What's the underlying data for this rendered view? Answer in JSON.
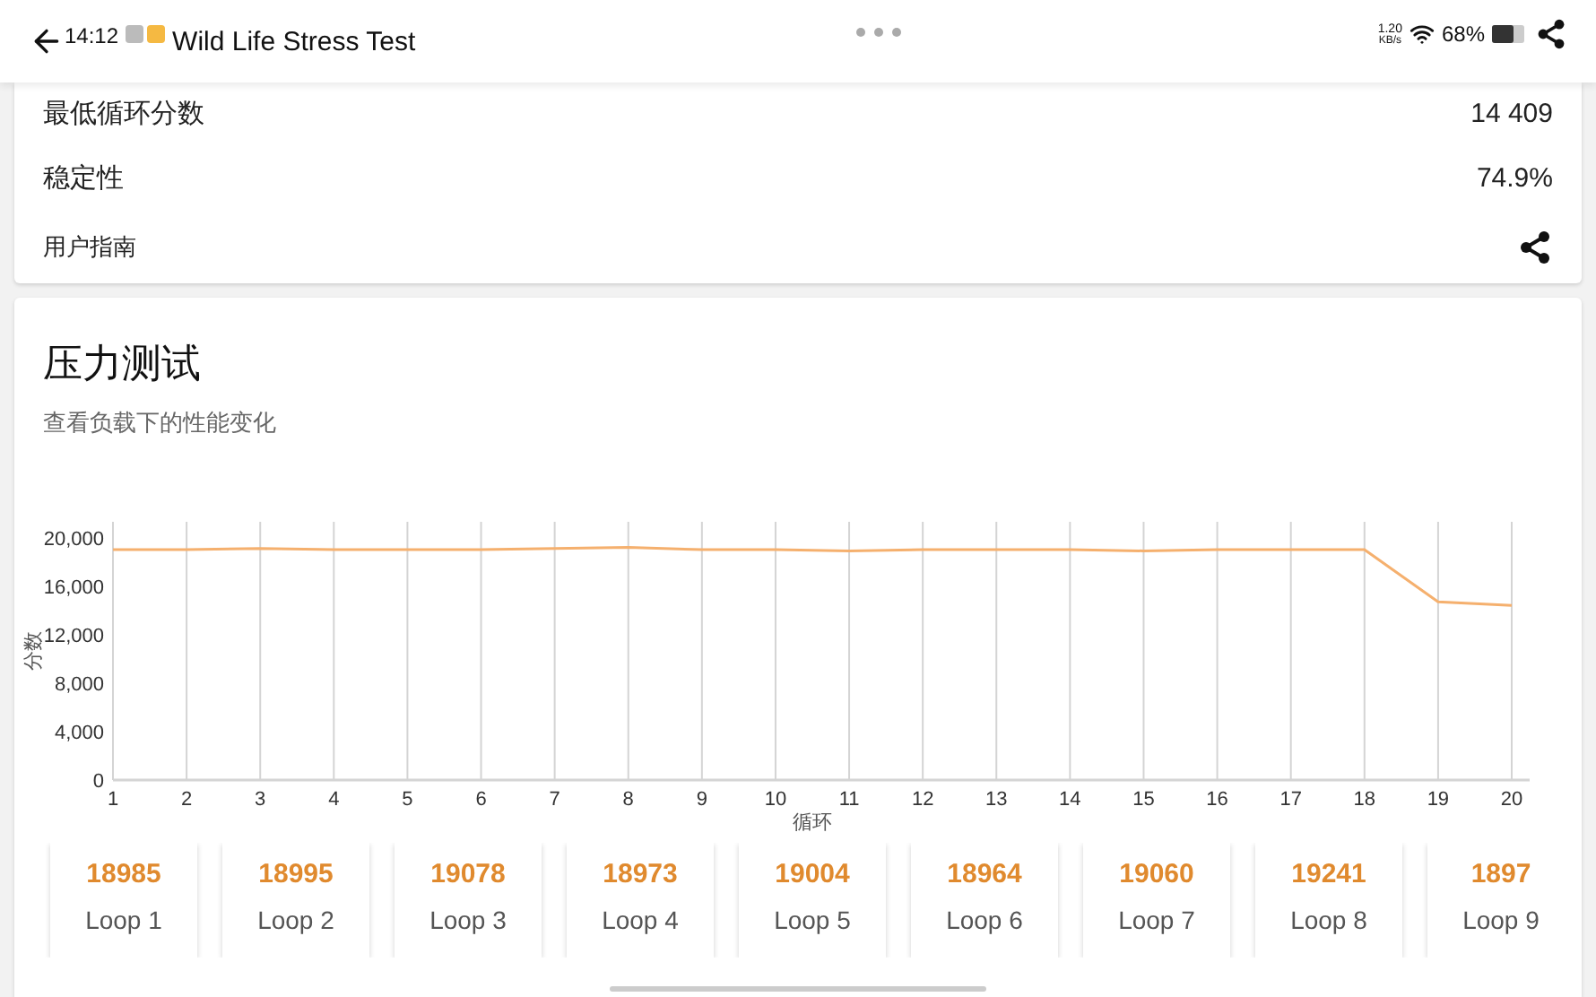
{
  "status_bar": {
    "time": "14:12",
    "speed_value": "1.20",
    "speed_unit": "KB/s",
    "battery": "68%"
  },
  "app_bar": {
    "title": "Wild Life Stress Test"
  },
  "summary": {
    "rows": [
      {
        "label": "最低循环分数",
        "value": "14 409"
      },
      {
        "label": "稳定性",
        "value": "74.9%"
      }
    ],
    "guide": "用户指南"
  },
  "stress_test": {
    "title": "压力测试",
    "subtitle": "查看负载下的性能变化",
    "chart_data": {
      "type": "line",
      "xlabel": "循环",
      "ylabel": "分数",
      "x": [
        1,
        2,
        3,
        4,
        5,
        6,
        7,
        8,
        9,
        10,
        11,
        12,
        13,
        14,
        15,
        16,
        17,
        18,
        19,
        20
      ],
      "series": [
        {
          "color": "#f5b06e",
          "values": [
            19000,
            19000,
            19100,
            19000,
            19000,
            19000,
            19100,
            19200,
            19000,
            19000,
            18900,
            19000,
            19000,
            19000,
            18900,
            19000,
            19000,
            19000,
            14700,
            14400
          ]
        }
      ],
      "xlim": [
        1,
        20
      ],
      "ylim": [
        0,
        21300
      ],
      "grid": true,
      "xticks": [
        1,
        2,
        3,
        4,
        5,
        6,
        7,
        8,
        9,
        10,
        11,
        12,
        13,
        14,
        15,
        16,
        17,
        18,
        19,
        20
      ],
      "yticks": [
        {
          "value": 0,
          "label": "0"
        },
        {
          "value": 4000,
          "label": "4,000"
        },
        {
          "value": 8000,
          "label": "8,000"
        },
        {
          "value": 12000,
          "label": "12,000"
        },
        {
          "value": 16000,
          "label": "16,000"
        },
        {
          "value": 20000,
          "label": "20,000"
        }
      ]
    },
    "loops": [
      {
        "score": "18985",
        "label": "Loop 1"
      },
      {
        "score": "18995",
        "label": "Loop 2"
      },
      {
        "score": "19078",
        "label": "Loop 3"
      },
      {
        "score": "18973",
        "label": "Loop 4"
      },
      {
        "score": "19004",
        "label": "Loop 5"
      },
      {
        "score": "18964",
        "label": "Loop 6"
      },
      {
        "score": "19060",
        "label": "Loop 7"
      },
      {
        "score": "19241",
        "label": "Loop 8"
      },
      {
        "score": "1897",
        "label": "Loop 9"
      }
    ]
  }
}
